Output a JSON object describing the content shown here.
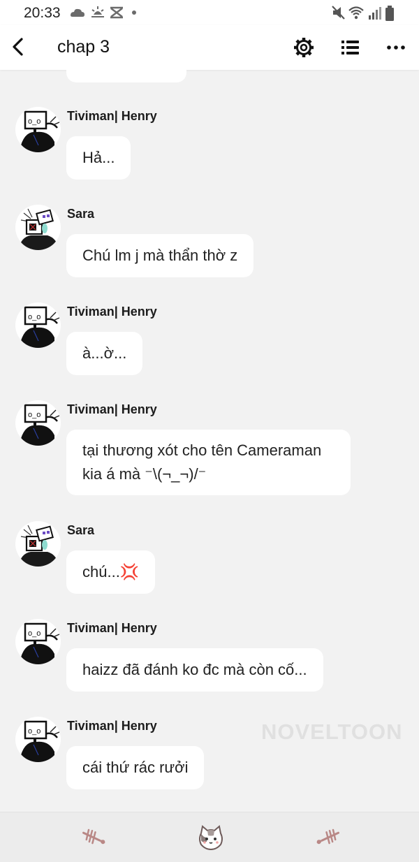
{
  "status_bar": {
    "time": "20:33",
    "left_icons": [
      "cloud-icon",
      "sunrise-icon",
      "capcut-icon",
      "dot-icon"
    ],
    "right_icons": [
      "mute-icon",
      "wifi-icon",
      "signal-icon",
      "battery-icon"
    ]
  },
  "header": {
    "title": "chap 3",
    "actions": [
      "settings-icon",
      "list-icon",
      "more-icon"
    ]
  },
  "messages": [
    {
      "sender": "Tiviman| Henry",
      "avatar": "henry",
      "text": "Hả..."
    },
    {
      "sender": "Sara",
      "avatar": "sara",
      "text": "Chú lm j mà thẩn thờ z"
    },
    {
      "sender": "Tiviman| Henry",
      "avatar": "henry",
      "text": "à...ờ..."
    },
    {
      "sender": "Tiviman| Henry",
      "avatar": "henry",
      "lines": [
        "tại thương xót cho tên Cameraman",
        "kia á mà ⁻\\(¬_¬)/⁻"
      ]
    },
    {
      "sender": "Sara",
      "avatar": "sara",
      "text": "chú...💢"
    },
    {
      "sender": "Tiviman| Henry",
      "avatar": "henry",
      "text": "haizz đã đánh ko đc mà còn cố..."
    },
    {
      "sender": "Tiviman| Henry",
      "avatar": "henry",
      "text": "cái thứ rác rưởi"
    }
  ],
  "watermark": "NOVELTOON",
  "bottom_nav": [
    "fishbone-icon",
    "cat-icon",
    "fishbone-icon"
  ],
  "colors": {
    "background": "#f2f2f2",
    "bubble": "#ffffff",
    "nav": "#ececec",
    "accent": "#b98886"
  }
}
